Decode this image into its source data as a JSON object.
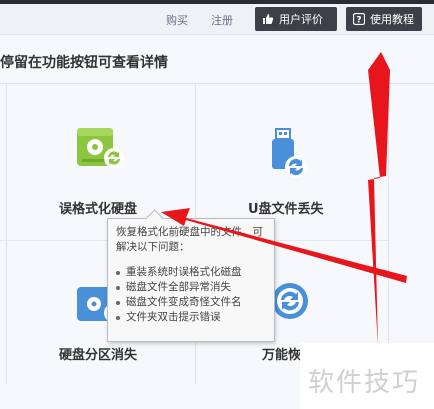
{
  "topbar": {
    "links": [
      {
        "label": "购买"
      },
      {
        "label": "注册"
      }
    ],
    "buttons": [
      {
        "label": "用户评价",
        "icon": "thumbs-up-icon"
      },
      {
        "label": "使用教程",
        "icon": "question-icon"
      }
    ]
  },
  "main": {
    "heading": "停留在功能按钮可查看详情",
    "tiles": [
      {
        "label": "误格式化硬盘",
        "icon": "hard-drive-recover-icon",
        "color": "#8cc63f"
      },
      {
        "label": "U盘文件丢失",
        "icon": "usb-drive-recover-icon",
        "color": "#4a90d9"
      },
      {
        "label": "硬盘分区消失",
        "icon": "partition-recover-icon",
        "color": "#4a90d9"
      },
      {
        "label": "万能恢",
        "icon": "universal-recover-icon",
        "color": "#4a90d9"
      }
    ]
  },
  "tooltip": {
    "intro": "恢复格式化前硬盘中的文件，可解决以下问题：",
    "items": [
      "重装系统时误格式化磁盘",
      "磁盘文件全部异常消失",
      "磁盘文件变成奇怪文件名",
      "文件夹双击提示错误"
    ]
  },
  "watermark": "软件技巧",
  "colors": {
    "annotation_arrow": "#e8161c",
    "button_bg": "#3d4048"
  }
}
